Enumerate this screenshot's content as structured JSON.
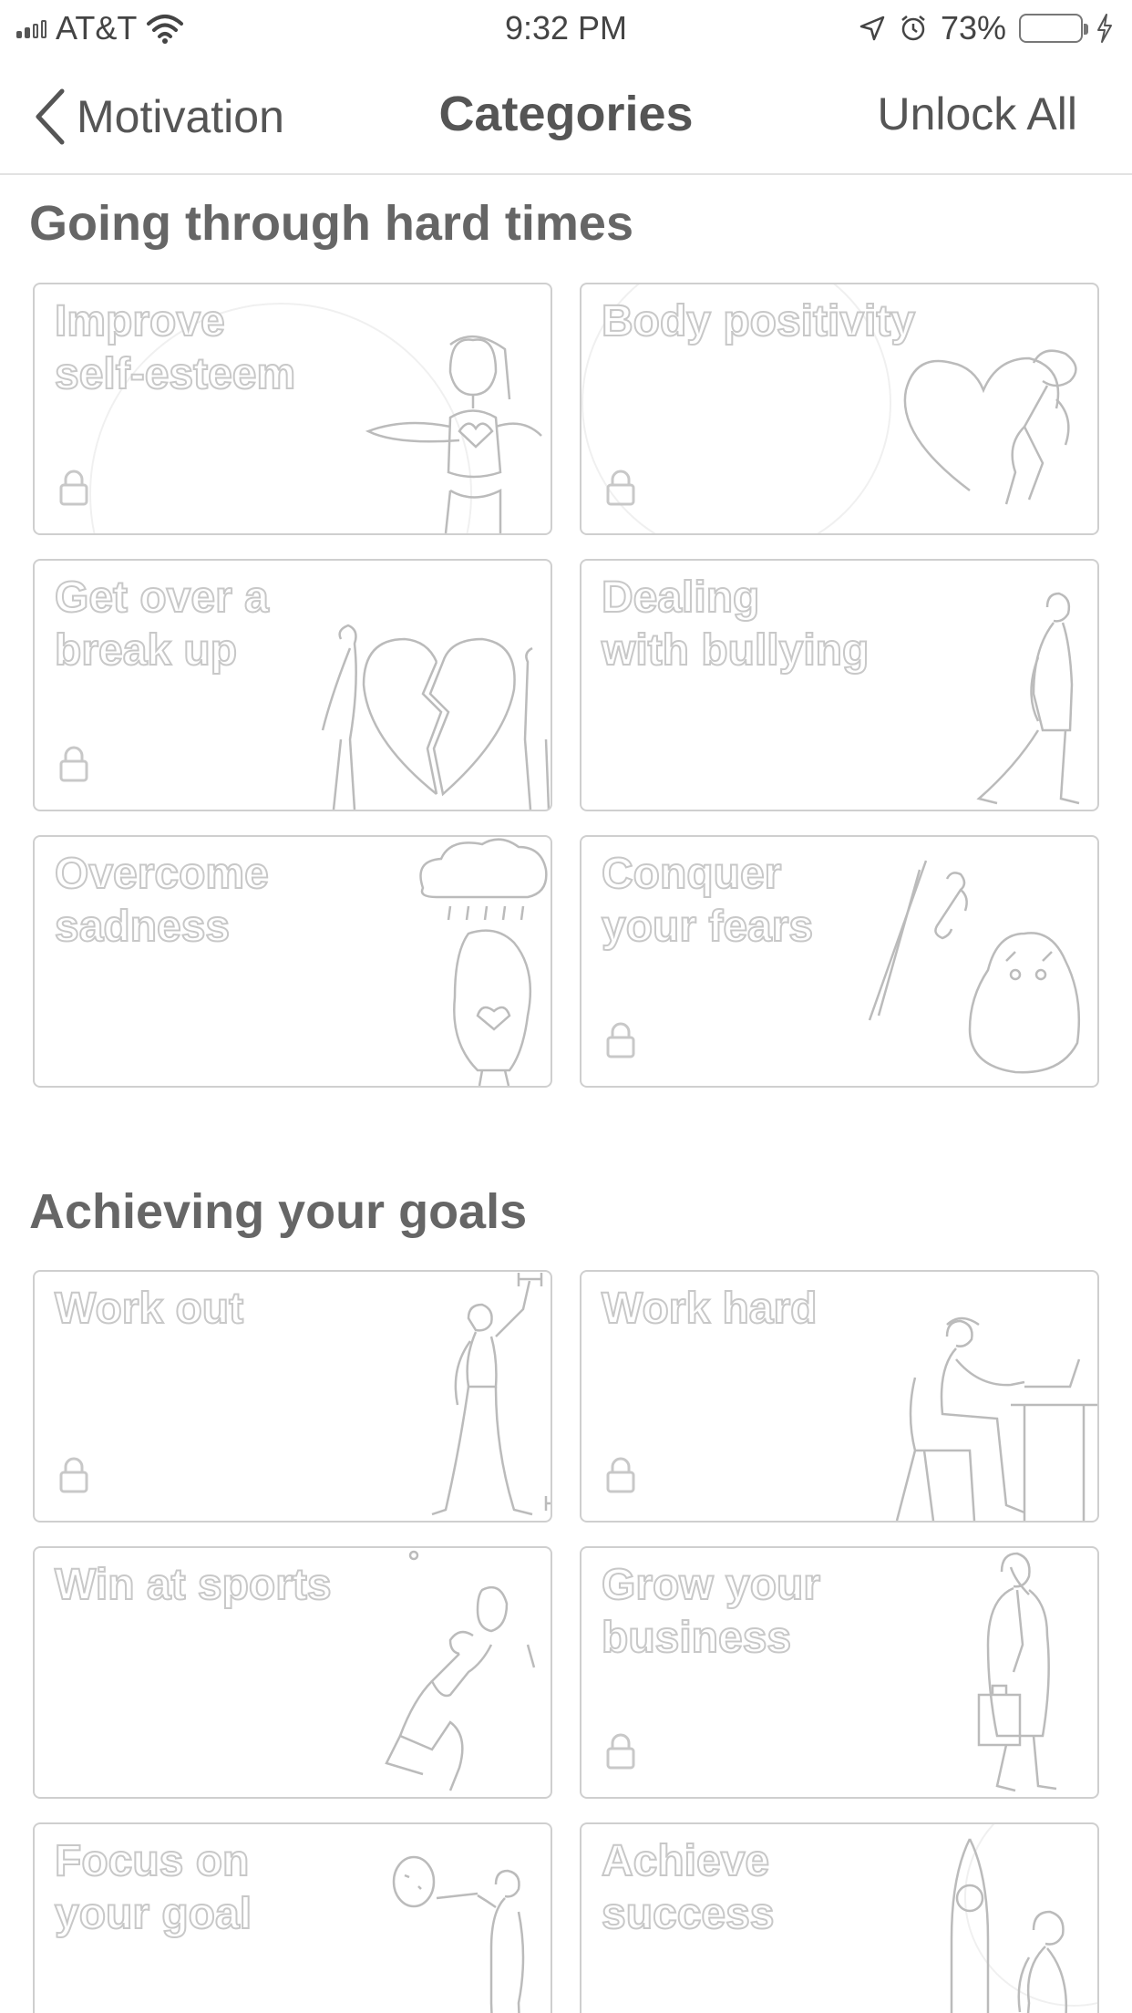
{
  "status_bar": {
    "carrier": "AT&T",
    "time": "9:32 PM",
    "battery": "73%",
    "icons": [
      "signal-icon",
      "wifi-icon",
      "location-icon",
      "alarm-icon",
      "battery-icon",
      "charging-icon"
    ]
  },
  "nav": {
    "back_label": "Motivation",
    "title": "Categories",
    "action_label": "Unlock All"
  },
  "sections": [
    {
      "title": "Going through hard times",
      "cards": [
        {
          "title": "Improve\nself-esteem",
          "locked": true,
          "icon": "heart-hands-woman-illustration"
        },
        {
          "title": "Body positivity",
          "locked": true,
          "icon": "heart-person-illustration"
        },
        {
          "title": "Get over a\nbreak up",
          "locked": true,
          "icon": "broken-heart-illustration"
        },
        {
          "title": "Dealing\nwith bullying",
          "locked": false,
          "icon": "walking-man-illustration"
        },
        {
          "title": "Overcome\nsadness",
          "locked": false,
          "icon": "rain-cloud-person-illustration"
        },
        {
          "title": "Conquer\nyour fears",
          "locked": true,
          "icon": "knight-monster-illustration"
        }
      ]
    },
    {
      "title": "Achieving your goals",
      "cards": [
        {
          "title": "Work out",
          "locked": true,
          "icon": "dumbbell-woman-illustration"
        },
        {
          "title": "Work hard",
          "locked": true,
          "icon": "desk-laptop-man-illustration"
        },
        {
          "title": "Win at sports",
          "locked": false,
          "icon": "ball-player-illustration"
        },
        {
          "title": "Grow your\nbusiness",
          "locked": true,
          "icon": "businessman-briefcase-illustration"
        },
        {
          "title": "Focus on\nyour goal",
          "locked": false,
          "icon": "dart-target-illustration"
        },
        {
          "title": "Achieve success",
          "locked": false,
          "icon": "rocket-person-illustration"
        }
      ]
    }
  ],
  "colors": {
    "text": "#555555",
    "card_border": "#cfcfcf",
    "divider": "#e2e2e2",
    "background": "#ffffff"
  }
}
